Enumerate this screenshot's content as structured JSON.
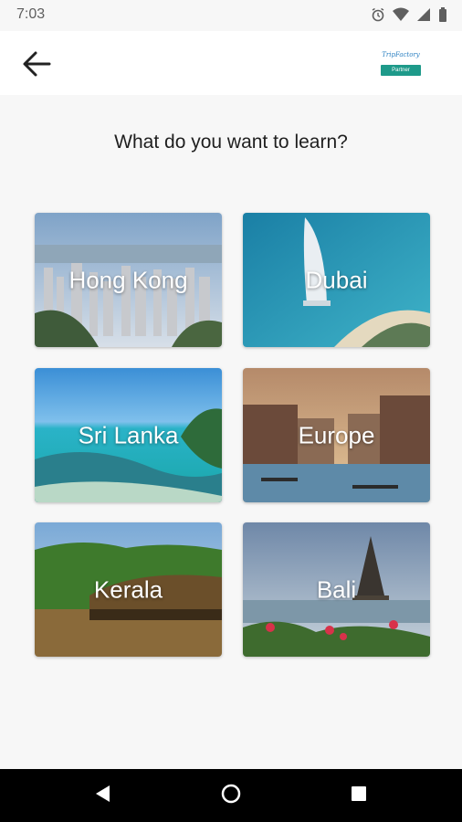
{
  "status_bar": {
    "time": "7:03",
    "icons": [
      "alarm-icon",
      "wifi-icon",
      "signal-icon",
      "battery-icon"
    ]
  },
  "app_bar": {
    "back_icon": "arrow-left-icon",
    "logo": {
      "brand_text": "TripFactory",
      "badge_text": "Partner"
    }
  },
  "page": {
    "heading": "What do you want to learn?"
  },
  "destinations": [
    {
      "label": "Hong Kong"
    },
    {
      "label": "Dubai"
    },
    {
      "label": "Sri Lanka"
    },
    {
      "label": "Europe"
    },
    {
      "label": "Kerala"
    },
    {
      "label": "Bali"
    }
  ],
  "nav_bar": {
    "icons": [
      "nav-back-icon",
      "nav-home-icon",
      "nav-recent-icon"
    ]
  },
  "colors": {
    "background": "#f7f7f7",
    "app_bar": "#ffffff",
    "nav_bar": "#000000",
    "logo_badge": "#1e9a8a",
    "logo_text": "#2a7fc1"
  }
}
